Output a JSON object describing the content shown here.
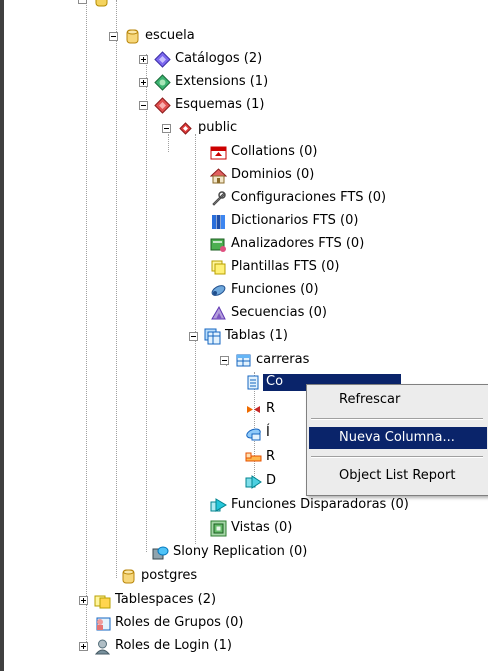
{
  "tree": {
    "nodes": [
      {
        "label": "escuela",
        "icon": "database-icon"
      },
      {
        "label": "Catálogos (2)",
        "icon": "catalog-icon"
      },
      {
        "label": "Extensions (1)",
        "icon": "extension-icon"
      },
      {
        "label": "Esquemas (1)",
        "icon": "schemas-icon"
      },
      {
        "label": "public",
        "icon": "schema-icon"
      },
      {
        "label": "Collations (0)",
        "icon": "collation-icon"
      },
      {
        "label": "Dominios (0)",
        "icon": "domain-icon"
      },
      {
        "label": "Configuraciones FTS (0)",
        "icon": "fts-config-icon"
      },
      {
        "label": "Dictionarios FTS (0)",
        "icon": "fts-dictionary-icon"
      },
      {
        "label": "Analizadores FTS (0)",
        "icon": "fts-parser-icon"
      },
      {
        "label": "Plantillas FTS (0)",
        "icon": "fts-template-icon"
      },
      {
        "label": "Funciones (0)",
        "icon": "function-icon"
      },
      {
        "label": "Secuencias (0)",
        "icon": "sequence-icon"
      },
      {
        "label": "Tablas (1)",
        "icon": "tables-icon"
      },
      {
        "label": "carreras",
        "icon": "table-icon"
      },
      {
        "label": "Co",
        "icon": "columns-icon"
      },
      {
        "label": "R",
        "icon": "rules-icon"
      },
      {
        "label": "Í",
        "icon": "indexes-icon"
      },
      {
        "label": "R",
        "icon": "constraints-icon"
      },
      {
        "label": "D",
        "icon": "triggers-icon"
      },
      {
        "label": "Funciones Disparadoras (0)",
        "icon": "trigger-function-icon"
      },
      {
        "label": "Vistas (0)",
        "icon": "view-icon"
      },
      {
        "label": "Slony Replication (0)",
        "icon": "slony-icon"
      },
      {
        "label": "postgres",
        "icon": "database-icon"
      },
      {
        "label": "Tablespaces (2)",
        "icon": "tablespace-icon"
      },
      {
        "label": "Roles de Grupos (0)",
        "icon": "group-roles-icon"
      },
      {
        "label": "Roles de Login (1)",
        "icon": "login-roles-icon"
      }
    ]
  },
  "context_menu": {
    "items": [
      "Refrescar",
      "Nueva Columna...",
      "Object List Report"
    ],
    "selected": "Nueva Columna..."
  },
  "colors": {
    "selection": "#0a246a",
    "menu_bg": "#ececec"
  }
}
